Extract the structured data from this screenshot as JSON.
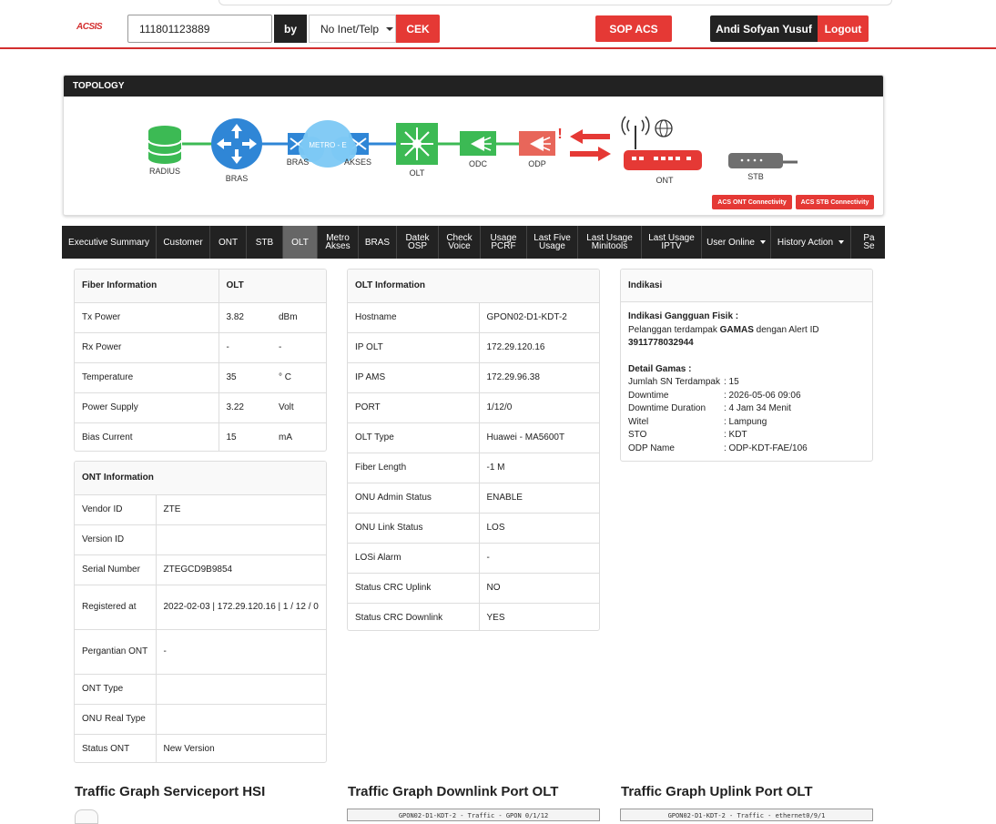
{
  "header": {
    "logo": "ACSIS",
    "search_value": "111801123889",
    "by_label": "by",
    "search_type": "No Inet/Telp",
    "cek_label": "CEK",
    "sop_label": "SOP ACS",
    "user_name": "Andi Sofyan Yusuf",
    "logout_label": "Logout"
  },
  "topology": {
    "title": "TOPOLOGY",
    "nodes": {
      "radius": "RADIUS",
      "bras": "BRAS",
      "bras2": "BRAS",
      "metro": "METRO - E",
      "akses": "AKSES",
      "olt": "OLT",
      "odc": "ODC",
      "odp": "ODP",
      "ont": "ONT",
      "stb": "STB"
    },
    "alert_mark": "!",
    "acs_ont": "ACS ONT Connectivity",
    "acs_stb": "ACS STB Connectivity"
  },
  "tabs": [
    {
      "label": "Executive Summary"
    },
    {
      "label": "Customer"
    },
    {
      "label": "ONT"
    },
    {
      "label": "STB"
    },
    {
      "label": "OLT"
    },
    {
      "label": "Metro\nAkses"
    },
    {
      "label": "BRAS"
    },
    {
      "label": "Datek\nOSP"
    },
    {
      "label": "Check\nVoice"
    },
    {
      "label": "Usage\nPCRF"
    },
    {
      "label": "Last Five\nUsage"
    },
    {
      "label": "Last Usage\nMinitools"
    },
    {
      "label": "Last Usage\nIPTV"
    },
    {
      "label": "User Online"
    },
    {
      "label": "History Action"
    },
    {
      "label": "Pa\nSe"
    }
  ],
  "fiber": {
    "header": [
      "Fiber Information",
      "OLT"
    ],
    "rows": [
      [
        "Tx Power",
        "3.82",
        "dBm"
      ],
      [
        "Rx Power",
        "-",
        "-"
      ],
      [
        "Temperature",
        "35",
        "° C"
      ],
      [
        "Power Supply",
        "3.22",
        "Volt"
      ],
      [
        "Bias Current",
        "15",
        "mA"
      ]
    ]
  },
  "ont_info": {
    "header": "ONT Information",
    "rows": [
      [
        "Vendor ID",
        "ZTE"
      ],
      [
        "Version ID",
        ""
      ],
      [
        "Serial Number",
        "ZTEGCD9B9854"
      ],
      [
        "Registered at",
        "2022-02-03 | 172.29.120.16 | 1 / 12 / 0"
      ],
      [
        "Pergantian ONT",
        "-"
      ],
      [
        "ONT Type",
        ""
      ],
      [
        "ONU Real Type",
        ""
      ],
      [
        "Status ONT",
        "New Version"
      ]
    ]
  },
  "olt_info": {
    "header": "OLT Information",
    "rows": [
      [
        "Hostname",
        "GPON02-D1-KDT-2"
      ],
      [
        "IP OLT",
        "172.29.120.16"
      ],
      [
        "IP AMS",
        "172.29.96.38"
      ],
      [
        "PORT",
        "1/12/0"
      ],
      [
        "OLT Type",
        "Huawei - MA5600T"
      ],
      [
        "Fiber Length",
        "-1 M"
      ],
      [
        "ONU Admin Status",
        "ENABLE"
      ],
      [
        "ONU Link Status",
        "LOS"
      ],
      [
        "LOSi Alarm",
        "-"
      ],
      [
        "Status CRC Uplink",
        "NO"
      ],
      [
        "Status CRC Downlink",
        "YES"
      ]
    ]
  },
  "indikasi": {
    "header": "Indikasi",
    "title": "Indikasi Gangguan Fisik :",
    "line1_pre": "Pelanggan terdampak",
    "line1_bold": "GAMAS",
    "line1_post": "dengan Alert ID",
    "alert_id": "3911778032944",
    "detail_title": "Detail Gamas :",
    "details": [
      [
        "Jumlah SN Terdampak",
        ": 15"
      ],
      [
        "Downtime",
        ": 2026-05-06 09:06"
      ],
      [
        "Downtime Duration",
        ": 4 Jam 34 Menit"
      ],
      [
        "Witel",
        ": Lampung"
      ],
      [
        "STO",
        ": KDT"
      ],
      [
        "ODP Name",
        ": ODP-KDT-FAE/106"
      ]
    ]
  },
  "graphs": {
    "hsi_title": "Traffic Graph Serviceport HSI",
    "down_title": "Traffic Graph Downlink Port OLT",
    "up_title": "Traffic Graph Uplink Port OLT",
    "down_caption": "GPON02-D1-KDT-2 - Traffic - GPON 0/1/12",
    "up_caption": "GPON02-D1-KDT-2 - Traffic - ethernet0/9/1"
  },
  "colors": {
    "accent": "#e53935",
    "dark": "#222222",
    "green": "#3cba54",
    "blue": "#2f86d6"
  }
}
